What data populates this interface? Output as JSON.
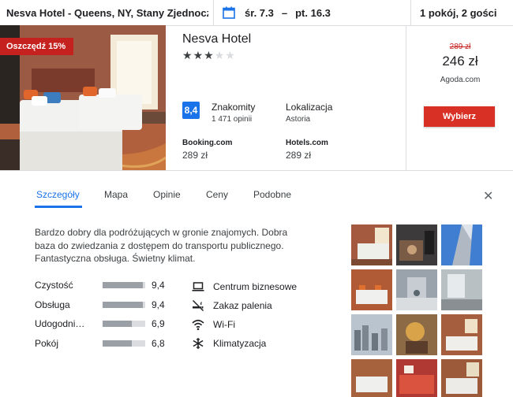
{
  "search": {
    "hotel": "Nesva Hotel - Queens, NY, Stany Zjednoczone",
    "check_in": "śr. 7.3",
    "dash": "–",
    "check_out": "pt. 16.3",
    "guests": "1 pokój, 2 gości",
    "calendar_icon": "calendar-icon"
  },
  "hotel": {
    "badge": "Oszczędź 15%",
    "name": "Nesva Hotel",
    "stars_total": 5,
    "stars_filled": 3,
    "rating_score": "8,4",
    "rating_label": "Znakomity",
    "rating_count": "1 471 opinii",
    "location_label": "Lokalizacja",
    "location_value": "Astoria",
    "providers": [
      {
        "name": "Booking.com",
        "price": "289 zł"
      },
      {
        "name": "Hotels.com",
        "price": "289 zł"
      }
    ],
    "price_old": "289 zł",
    "price_new": "246 zł",
    "price_source": "Agoda.com",
    "select_label": "Wybierz"
  },
  "tabs": {
    "items": [
      "Szczegóły",
      "Mapa",
      "Opinie",
      "Ceny",
      "Podobne"
    ],
    "active": 0,
    "close_icon": "close-icon"
  },
  "details": {
    "description": "Bardzo dobry dla podróżujących w gronie znajomych. Dobra baza do zwiedzania z dostępem do transportu publicznego. Fantastyczna obsługa. Świetny klimat.",
    "ratings": [
      {
        "label": "Czystość",
        "value": "9,4",
        "fraction": 0.94
      },
      {
        "label": "Obsługa",
        "value": "9,4",
        "fraction": 0.94
      },
      {
        "label": "Udogodni…",
        "value": "6,9",
        "fraction": 0.69
      },
      {
        "label": "Pokój",
        "value": "6,8",
        "fraction": 0.68
      }
    ],
    "amenities": [
      {
        "label": "Centrum biznesowe",
        "icon": "laptop-icon"
      },
      {
        "label": "Zakaz palenia",
        "icon": "no-smoking-icon"
      },
      {
        "label": "Wi-Fi",
        "icon": "wifi-icon"
      },
      {
        "label": "Klimatyzacja",
        "icon": "snowflake-icon"
      }
    ]
  },
  "colors": {
    "accent": "#1a73e8",
    "badge": "#c5221f",
    "select_button": "#d93025",
    "rating_box": "#1a73e8"
  }
}
